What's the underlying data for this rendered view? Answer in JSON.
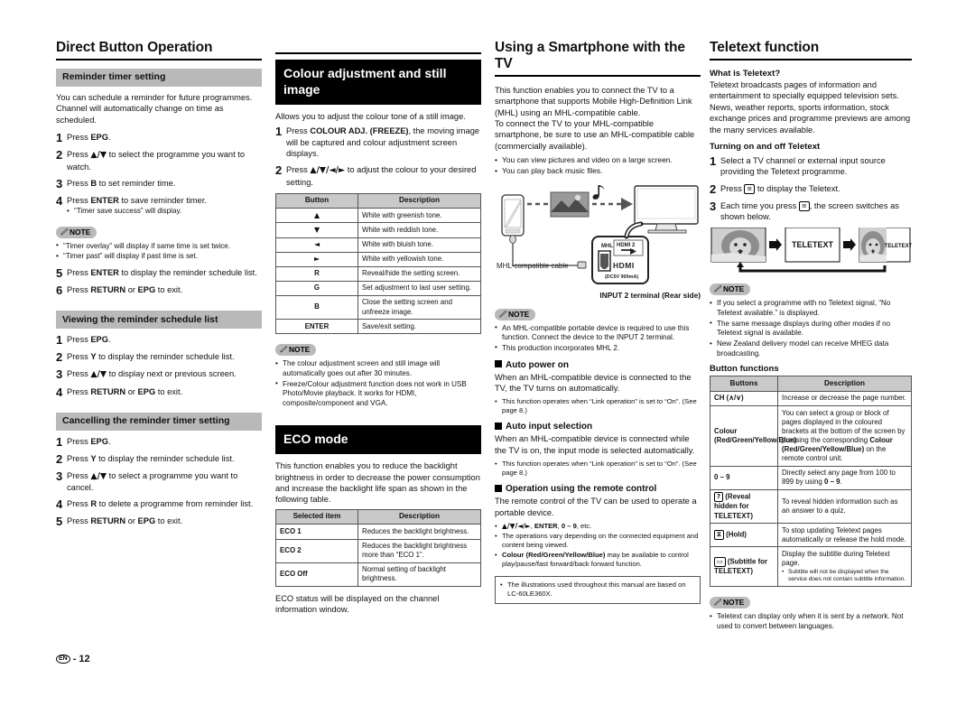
{
  "footer": {
    "lang_badge": "EN",
    "separator": "-",
    "page_number": "12"
  },
  "col1": {
    "title": "Direct Button Operation",
    "sec1": {
      "heading": "Reminder timer setting",
      "intro": "You can schedule a reminder for future programmes. Channel will automatically change on time as scheduled.",
      "steps": [
        {
          "num": "1",
          "text": "Press EPG."
        },
        {
          "num": "2",
          "text": "Press ▲/▼ to select the programme you want to watch."
        },
        {
          "num": "3",
          "text": "Press B to set reminder time."
        },
        {
          "num": "4",
          "text": "Press ENTER to save reminder timer."
        },
        {
          "num": "5",
          "text": "Press ENTER to display the reminder schedule list."
        },
        {
          "num": "6",
          "text": "Press RETURN or EPG to exit."
        }
      ],
      "step4_bullet": "“Timer save success” will display.",
      "note_label": "NOTE",
      "notes": [
        "“Timer overlay” will display if same time is set twice.",
        "“Timer past” will display if past time is set."
      ]
    },
    "sec2": {
      "heading": "Viewing the reminder schedule list",
      "steps": [
        {
          "num": "1",
          "text": "Press EPG."
        },
        {
          "num": "2",
          "text": "Press Y to display the reminder schedule list."
        },
        {
          "num": "3",
          "text": "Press ▲/▼ to display next or previous screen."
        },
        {
          "num": "4",
          "text": "Press RETURN or EPG to exit."
        }
      ]
    },
    "sec3": {
      "heading": "Cancelling the reminder timer setting",
      "steps": [
        {
          "num": "1",
          "text": "Press EPG."
        },
        {
          "num": "2",
          "text": "Press Y to display the reminder schedule list."
        },
        {
          "num": "3",
          "text": "Press ▲/▼ to select a programme you want to cancel."
        },
        {
          "num": "4",
          "text": "Press R to delete a programme from reminder list."
        },
        {
          "num": "5",
          "text": "Press RETURN or EPG to exit."
        }
      ]
    }
  },
  "col2": {
    "sec1": {
      "heading": "Colour adjustment and still image",
      "intro": "Allows you to adjust the colour tone of a still image.",
      "steps": [
        {
          "num": "1",
          "text": "Press COLOUR ADJ. (FREEZE), the moving image will be captured and colour adjustment screen displays."
        },
        {
          "num": "2",
          "text": "Press ▲/▼/◄/► to adjust the colour to your desired setting."
        }
      ],
      "table": {
        "headers": [
          "Button",
          "Description"
        ],
        "rows": [
          {
            "button": "▲",
            "description": "White with greenish tone."
          },
          {
            "button": "▼",
            "description": "White with reddish tone."
          },
          {
            "button": "◄",
            "description": "White with bluish tone."
          },
          {
            "button": "►",
            "description": "White with yellowish tone."
          },
          {
            "button": "R",
            "description": "Reveal/hide the setting screen."
          },
          {
            "button": "G",
            "description": "Set adjustment to last user setting."
          },
          {
            "button": "B",
            "description": "Close the setting screen and unfreeze image."
          },
          {
            "button": "ENTER",
            "description": "Save/exit setting."
          }
        ]
      },
      "note_label": "NOTE",
      "notes": [
        "The colour adjustment screen and still image will automatically goes out after 30 minutes.",
        "Freeze/Colour adjustment function does not work in USB Photo/Movie playback. It works for HDMI, composite/component and VGA."
      ]
    },
    "sec2": {
      "heading": "ECO mode",
      "intro": "This function enables you to reduce the backlight brightness in order to decrease the power consumption and increase the backlight life span as shown in the following table.",
      "table": {
        "headers": [
          "Selected item",
          "Description"
        ],
        "rows": [
          {
            "item": "ECO 1",
            "description": "Reduces the backlight brightness."
          },
          {
            "item": "ECO 2",
            "description": "Reduces the backlight brightness more than “ECO 1”."
          },
          {
            "item": "ECO Off",
            "description": "Normal setting of backlight brightness."
          }
        ]
      },
      "outro": "ECO status will be displayed on the channel information window."
    }
  },
  "col3": {
    "title": "Using a Smartphone with the TV",
    "intro": "This function enables you to connect the TV to a smartphone that supports Mobile High-Definition Link (MHL) using an MHL-compatible cable.\nTo connect the TV to your MHL-compatible smartphone, be sure to use an MHL-compatible cable (commercially available).",
    "bullets": [
      "You can view pictures and video on a large screen.",
      "You can play back music files."
    ],
    "illustration": {
      "cable_label": "MHL-compatible cable",
      "mhl_label": "MHL",
      "hdmi2_label": "HDMI 2",
      "hdmi_logo": "HDMI",
      "power_label": "(DC5V 900mA)",
      "terminal_caption": "INPUT 2 terminal (Rear side)"
    },
    "note_label": "NOTE",
    "notes": [
      "An MHL-compatible portable device is required to use this function. Connect the device to the INPUT 2 terminal.",
      "This production incorporates MHL 2."
    ],
    "sub1": {
      "heading": "Auto power on",
      "body": "When an MHL-compatible device is connected to the TV, the TV turns on automatically.",
      "bullets": [
        "This function operates when “Link operation” is set to “On”. (See page 8.)"
      ]
    },
    "sub2": {
      "heading": "Auto input selection",
      "body": "When an MHL-compatible device is connected while the TV is on, the input mode is selected automatically.",
      "bullets": [
        "This function operates when “Link operation” is set to “On”. (See page 8.)"
      ]
    },
    "sub3": {
      "heading": "Operation using the remote control",
      "body": "The remote control of the TV can be used to operate a portable device.",
      "bullets": [
        "▲/▼/◄/►, ENTER, 0 – 9, etc.",
        "The operations vary depending on the connected equipment and content being viewed.",
        "Colour (Red/Green/Yellow/Blue) may be available to control play/pause/fast forward/back forward function."
      ]
    },
    "box_note": [
      "The illustrations used throughout this manual are based on LC-60LE360X."
    ]
  },
  "col4": {
    "title": "Teletext function",
    "what_heading": "What is Teletext?",
    "what_body": "Teletext broadcasts pages of information and entertainment to specially equipped television sets. News, weather reports, sports information, stock exchange prices and programme previews are among the many services available.",
    "turn_heading": "Turning on and off Teletext",
    "steps": [
      {
        "num": "1",
        "text": "Select a TV channel or external input source providing the Teletext programme."
      },
      {
        "num": "2",
        "text": "Press ≡ to display the Teletext."
      },
      {
        "num": "3",
        "text": "Each time you press ≡, the screen switches as shown below."
      }
    ],
    "diagram": {
      "screen2_label": "TELETEXT",
      "screen3_label": "TELETEXT"
    },
    "note_label": "NOTE",
    "notes": [
      "If you select a programme with no Teletext signal, “No Teletext available.” is displayed.",
      "The same message displays during other modes if no Teletext signal is available.",
      "New Zealand delivery model can receive MHEG data broadcasting."
    ],
    "button_functions_heading": "Button functions",
    "table": {
      "headers": [
        "Buttons",
        "Description"
      ],
      "rows": [
        {
          "button": "CH (∧/∨)",
          "description": "Increase or decrease the page number."
        },
        {
          "button": "Colour (Red/Green/Yellow/Blue)",
          "description": "You can select a group or block of pages displayed in the coloured brackets at the bottom of the screen by pressing the corresponding Colour (Red/Green/Yellow/Blue) on the remote control unit."
        },
        {
          "button": "0 – 9",
          "description": "Directly select any page from 100 to 899 by using 0 – 9."
        },
        {
          "button": "(Reveal hidden for TELETEXT)",
          "button_icon": "?",
          "description": "To reveal hidden information such as an answer to a quiz."
        },
        {
          "button": "(Hold)",
          "button_icon": "··",
          "description": "To stop updating Teletext pages automatically or release the hold mode."
        },
        {
          "button": "(Subtitle for TELETEXT)",
          "button_icon": "▭",
          "description": "Display the subtitle during Teletext page.",
          "subnote": "Subtitle will not be displayed when the service does not contain subtitle information."
        }
      ]
    },
    "final_note_label": "NOTE",
    "final_notes": [
      "Teletext can display only when it is sent by a network. Not used to convert between languages."
    ]
  },
  "colors": {
    "gray_head": "#b9b9b9",
    "black_head": "#000000",
    "table_head": "#c9c9c9",
    "text": "#111111"
  }
}
